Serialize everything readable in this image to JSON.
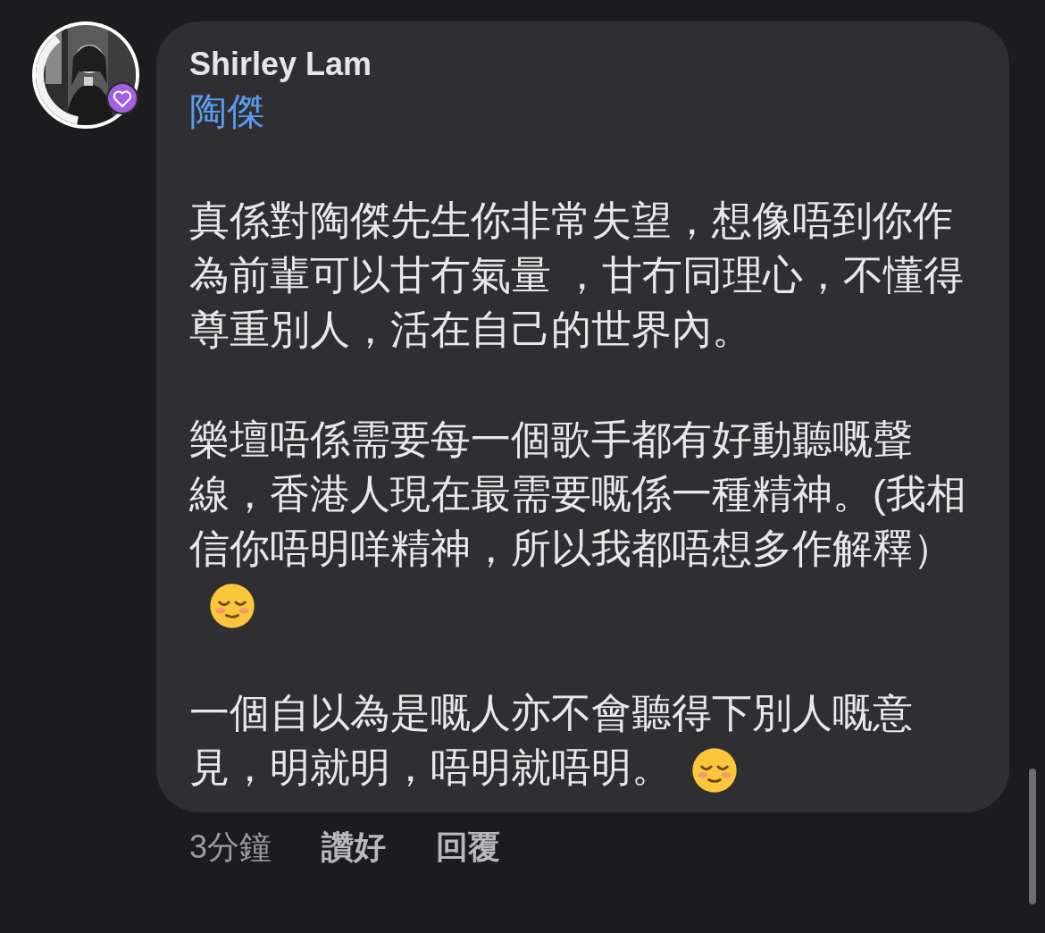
{
  "comment": {
    "author": "Shirley Lam",
    "mention": "陶傑",
    "paragraphs": [
      {
        "text": "真係對陶傑先生你非常失望，想像唔到你作為前輩可以甘冇氣量 ，甘冇同理心，不懂得尊重別人，活在自己的世界內。",
        "emoji": false
      },
      {
        "text": "樂壇唔係需要每一個歌手都有好動聽嘅聲線，香港人現在最需要嘅係一種精神。(我相信你唔明咩精神，所以我都唔想多作解釋）",
        "emoji": true
      },
      {
        "text": "一個自以為是嘅人亦不會聽得下別人嘅意見，明就明，唔明就唔明。",
        "emoji": true
      }
    ]
  },
  "footer": {
    "time": "3分鐘",
    "actions": [
      "讚好",
      "回覆"
    ]
  }
}
